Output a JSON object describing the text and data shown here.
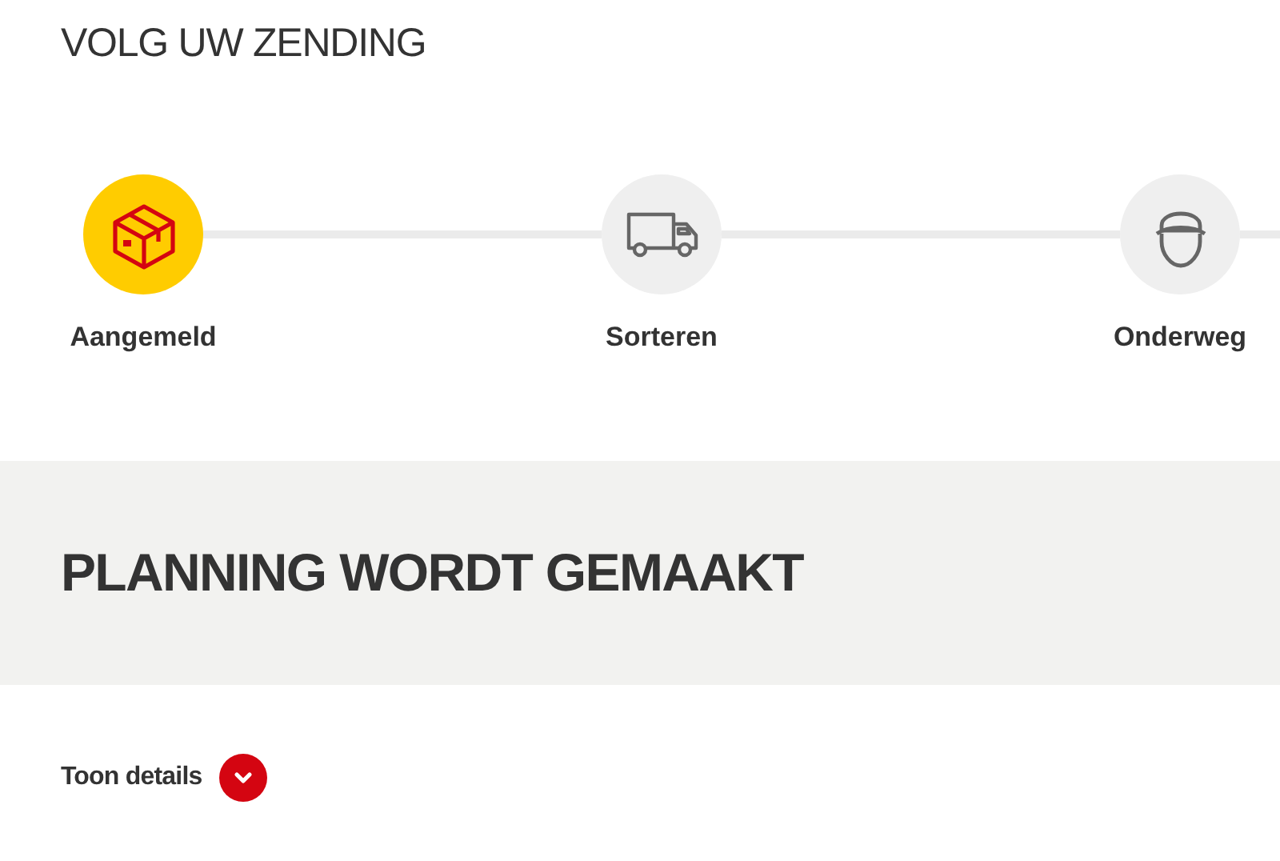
{
  "page_title": "VOLG UW ZENDING",
  "steps": [
    {
      "kind": "package",
      "label": "Aangemeld",
      "active": true
    },
    {
      "kind": "truck",
      "label": "Sorteren",
      "active": false
    },
    {
      "kind": "courier",
      "label": "Onderweg",
      "active": false
    }
  ],
  "status": {
    "heading": "PLANNING WORDT GEMAAKT"
  },
  "details_toggle": {
    "label": "Toon details",
    "expanded": false
  }
}
